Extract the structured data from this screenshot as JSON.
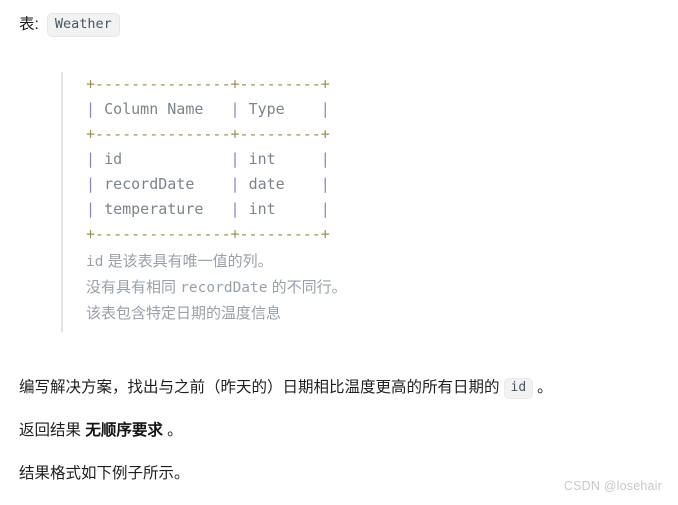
{
  "heading": {
    "label": "表:",
    "table_name": "Weather"
  },
  "schema_block": {
    "ascii_table": {
      "separator": "+---------------+---------+",
      "header": {
        "column_name": "Column Name",
        "type": "Type"
      },
      "rows": [
        {
          "column_name": "id",
          "type": "int"
        },
        {
          "column_name": "recordDate",
          "type": "date"
        },
        {
          "column_name": "temperature",
          "type": "int"
        }
      ]
    },
    "notes": [
      {
        "code": "id",
        "text": "是该表具有唯一值的列。"
      },
      {
        "prefix": "没有具有相同",
        "code": "recordDate",
        "suffix": "的不同行。"
      },
      {
        "text": "该表包含特定日期的温度信息"
      }
    ]
  },
  "paragraphs": {
    "task_before_code": "编写解决方案，找出与之前（昨天的）日期相比温度更高的所有日期的",
    "task_code": "id",
    "task_after_code": "。",
    "order_prefix": "返回结果",
    "order_bold": "无顺序要求",
    "order_suffix": "。",
    "format_note": "结果格式如下例子所示。"
  },
  "watermark": {
    "text": "CSDN @losehair"
  }
}
